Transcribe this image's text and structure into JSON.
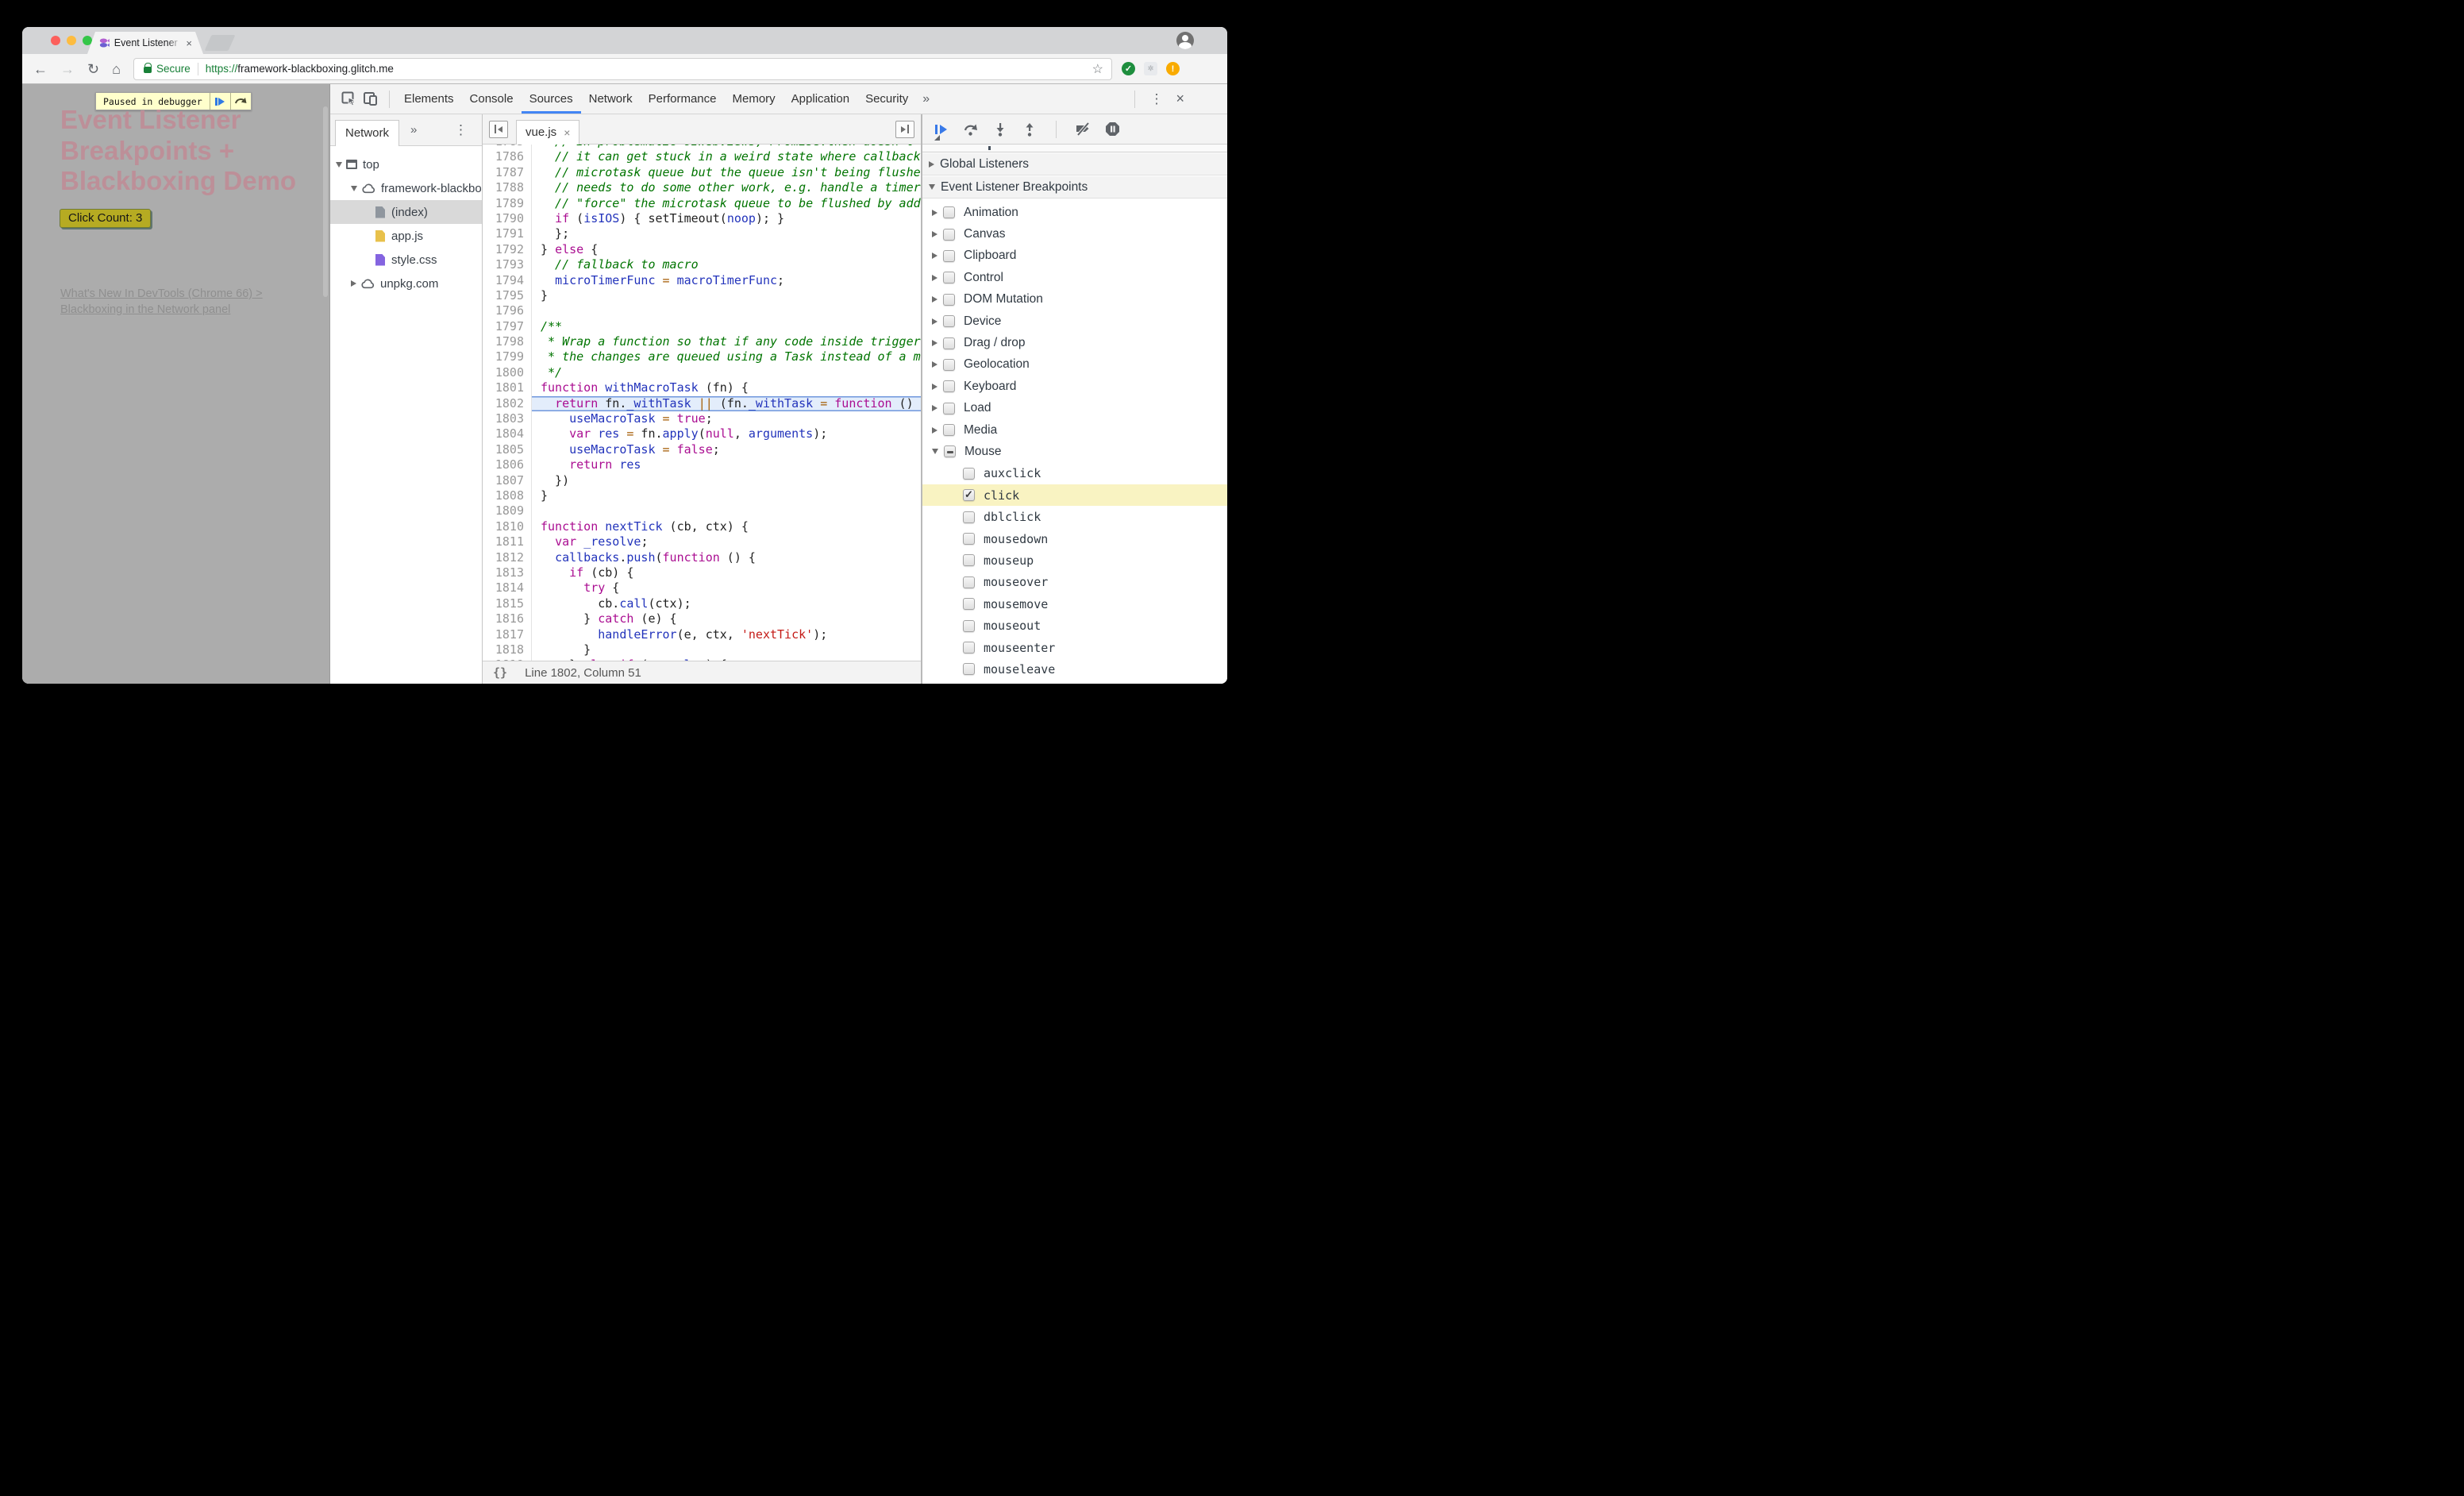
{
  "browser": {
    "tab_title": "Event Listener Breakpoints + B",
    "secure_label": "Secure",
    "url_scheme": "https://",
    "url_host": "framework-blackboxing.glitch.me"
  },
  "icons": {
    "back": "←",
    "forward": "→",
    "reload": "↻",
    "home": "⌂",
    "star": "☆",
    "overflow": "»",
    "menu": "⋮",
    "close": "×",
    "tab_close": "×",
    "braces": "{}",
    "ext_warning": "!",
    "ext_check": "✓",
    "ext_faint": "✲"
  },
  "page": {
    "paused_label": "Paused in debugger",
    "heading_line1": "Event Listener",
    "heading_line2": "Breakpoints +",
    "heading_line3": "Blackboxing Demo",
    "button_label": "Click Count: 3",
    "link_line1": "What's New In DevTools (Chrome 66) >",
    "link_line2": "Blackboxing in the Network panel"
  },
  "devtools": {
    "tabs": [
      {
        "label": "Elements"
      },
      {
        "label": "Console"
      },
      {
        "label": "Sources",
        "active": true
      },
      {
        "label": "Network"
      },
      {
        "label": "Performance"
      },
      {
        "label": "Memory"
      },
      {
        "label": "Application"
      },
      {
        "label": "Security"
      }
    ],
    "sidebar": {
      "tab_label": "Network",
      "tree": [
        {
          "kind": "frame",
          "label": "top",
          "expanded": true,
          "depth": 0
        },
        {
          "kind": "cloud",
          "label": "framework-blackboxing.glitch.me",
          "expanded": true,
          "depth": 1
        },
        {
          "kind": "file",
          "label": "(index)",
          "color": "#8f969e",
          "selected": true,
          "depth": 2
        },
        {
          "kind": "file",
          "label": "app.js",
          "color": "#e8c14b",
          "depth": 2
        },
        {
          "kind": "file",
          "label": "style.css",
          "color": "#8464e0",
          "depth": 2
        },
        {
          "kind": "cloud",
          "label": "unpkg.com",
          "expanded": false,
          "depth": 1
        }
      ]
    },
    "editor": {
      "file_tab_label": "vue.js",
      "status_text": "Line 1802, Column 51",
      "execution_line": 1802,
      "lines": [
        {
          "n": 1785,
          "t": [
            [
              "c",
              "  // In problematic UIWebViews, Promise.then doesn't completely break, but"
            ]
          ]
        },
        {
          "n": 1786,
          "t": [
            [
              "c",
              "  // it can get stuck in a weird state where callbacks are pushed into the"
            ]
          ]
        },
        {
          "n": 1787,
          "t": [
            [
              "c",
              "  // microtask queue but the queue isn't being flushed, until the browser"
            ]
          ]
        },
        {
          "n": 1788,
          "t": [
            [
              "c",
              "  // needs to do some other work, e.g. handle a timer. Therefore we can"
            ]
          ]
        },
        {
          "n": 1789,
          "t": [
            [
              "c",
              "  // \"force\" the microtask queue to be flushed by adding an empty timer."
            ]
          ]
        },
        {
          "n": 1790,
          "t": [
            [
              "p",
              "  "
            ],
            [
              "k",
              "if"
            ],
            [
              "p",
              " ("
            ],
            [
              "v",
              "isIOS"
            ],
            [
              "p",
              ") { setTimeout("
            ],
            [
              "v",
              "noop"
            ],
            [
              "p",
              "); }"
            ]
          ]
        },
        {
          "n": 1791,
          "t": [
            [
              "p",
              "  };"
            ]
          ]
        },
        {
          "n": 1792,
          "t": [
            [
              "p",
              "} "
            ],
            [
              "k",
              "else"
            ],
            [
              "p",
              " {"
            ]
          ]
        },
        {
          "n": 1793,
          "t": [
            [
              "c",
              "  // fallback to macro"
            ]
          ]
        },
        {
          "n": 1794,
          "t": [
            [
              "p",
              "  "
            ],
            [
              "v",
              "microTimerFunc"
            ],
            [
              "p",
              " "
            ],
            [
              "o",
              "="
            ],
            [
              "p",
              " "
            ],
            [
              "v",
              "macroTimerFunc"
            ],
            [
              "p",
              ";"
            ]
          ]
        },
        {
          "n": 1795,
          "t": [
            [
              "p",
              "}"
            ]
          ]
        },
        {
          "n": 1796,
          "t": []
        },
        {
          "n": 1797,
          "t": [
            [
              "c",
              "/**"
            ]
          ]
        },
        {
          "n": 1798,
          "t": [
            [
              "c",
              " * Wrap a function so that if any code inside triggers state change,"
            ]
          ]
        },
        {
          "n": 1799,
          "t": [
            [
              "c",
              " * the changes are queued using a Task instead of a microtask."
            ]
          ]
        },
        {
          "n": 1800,
          "t": [
            [
              "c",
              " */"
            ]
          ]
        },
        {
          "n": 1801,
          "t": [
            [
              "k",
              "function"
            ],
            [
              "p",
              " "
            ],
            [
              "v",
              "withMacroTask"
            ],
            [
              "p",
              " (fn) {"
            ]
          ]
        },
        {
          "n": 1802,
          "t": [
            [
              "p",
              "  "
            ],
            [
              "k",
              "return"
            ],
            [
              "p",
              " fn."
            ],
            [
              "v",
              "_withTask"
            ],
            [
              "p",
              " "
            ],
            [
              "o",
              "||"
            ],
            [
              "p",
              " (fn."
            ],
            [
              "v",
              "_withTask"
            ],
            [
              "p",
              " "
            ],
            [
              "o",
              "="
            ],
            [
              "p",
              " "
            ],
            [
              "k",
              "function"
            ],
            [
              "p",
              " () {"
            ]
          ]
        },
        {
          "n": 1803,
          "t": [
            [
              "p",
              "    "
            ],
            [
              "v",
              "useMacroTask"
            ],
            [
              "p",
              " "
            ],
            [
              "o",
              "="
            ],
            [
              "p",
              " "
            ],
            [
              "k",
              "true"
            ],
            [
              "p",
              ";"
            ]
          ]
        },
        {
          "n": 1804,
          "t": [
            [
              "p",
              "    "
            ],
            [
              "k",
              "var"
            ],
            [
              "p",
              " "
            ],
            [
              "v",
              "res"
            ],
            [
              "p",
              " "
            ],
            [
              "o",
              "="
            ],
            [
              "p",
              " fn."
            ],
            [
              "v",
              "apply"
            ],
            [
              "p",
              "("
            ],
            [
              "k",
              "null"
            ],
            [
              "p",
              ", "
            ],
            [
              "v",
              "arguments"
            ],
            [
              "p",
              ");"
            ]
          ]
        },
        {
          "n": 1805,
          "t": [
            [
              "p",
              "    "
            ],
            [
              "v",
              "useMacroTask"
            ],
            [
              "p",
              " "
            ],
            [
              "o",
              "="
            ],
            [
              "p",
              " "
            ],
            [
              "k",
              "false"
            ],
            [
              "p",
              ";"
            ]
          ]
        },
        {
          "n": 1806,
          "t": [
            [
              "p",
              "    "
            ],
            [
              "k",
              "return"
            ],
            [
              "p",
              " "
            ],
            [
              "v",
              "res"
            ]
          ]
        },
        {
          "n": 1807,
          "t": [
            [
              "p",
              "  })"
            ]
          ]
        },
        {
          "n": 1808,
          "t": [
            [
              "p",
              "}"
            ]
          ]
        },
        {
          "n": 1809,
          "t": []
        },
        {
          "n": 1810,
          "t": [
            [
              "k",
              "function"
            ],
            [
              "p",
              " "
            ],
            [
              "v",
              "nextTick"
            ],
            [
              "p",
              " (cb, ctx) {"
            ]
          ]
        },
        {
          "n": 1811,
          "t": [
            [
              "p",
              "  "
            ],
            [
              "k",
              "var"
            ],
            [
              "p",
              " "
            ],
            [
              "v",
              "_resolve"
            ],
            [
              "p",
              ";"
            ]
          ]
        },
        {
          "n": 1812,
          "t": [
            [
              "p",
              "  "
            ],
            [
              "v",
              "callbacks"
            ],
            [
              "p",
              "."
            ],
            [
              "v",
              "push"
            ],
            [
              "p",
              "("
            ],
            [
              "k",
              "function"
            ],
            [
              "p",
              " () {"
            ]
          ]
        },
        {
          "n": 1813,
          "t": [
            [
              "p",
              "    "
            ],
            [
              "k",
              "if"
            ],
            [
              "p",
              " (cb) {"
            ]
          ]
        },
        {
          "n": 1814,
          "t": [
            [
              "p",
              "      "
            ],
            [
              "k",
              "try"
            ],
            [
              "p",
              " {"
            ]
          ]
        },
        {
          "n": 1815,
          "t": [
            [
              "p",
              "        cb."
            ],
            [
              "v",
              "call"
            ],
            [
              "p",
              "(ctx);"
            ]
          ]
        },
        {
          "n": 1816,
          "t": [
            [
              "p",
              "      } "
            ],
            [
              "k",
              "catch"
            ],
            [
              "p",
              " (e) {"
            ]
          ]
        },
        {
          "n": 1817,
          "t": [
            [
              "p",
              "        "
            ],
            [
              "v",
              "handleError"
            ],
            [
              "p",
              "(e, ctx, "
            ],
            [
              "s",
              "'nextTick'"
            ],
            [
              "p",
              ");"
            ]
          ]
        },
        {
          "n": 1818,
          "t": [
            [
              "p",
              "      }"
            ]
          ]
        },
        {
          "n": 1819,
          "t": [
            [
              "p",
              "    } "
            ],
            [
              "k",
              "else"
            ],
            [
              "p",
              " "
            ],
            [
              "k",
              "if"
            ],
            [
              "p",
              " ("
            ],
            [
              "v",
              "_resolve"
            ],
            [
              "p",
              ") {"
            ]
          ]
        }
      ]
    },
    "breakpoints": {
      "section1": "Global Listeners",
      "section2": "Event Listener Breakpoints",
      "categories": [
        {
          "label": "Animation"
        },
        {
          "label": "Canvas"
        },
        {
          "label": "Clipboard"
        },
        {
          "label": "Control"
        },
        {
          "label": "DOM Mutation"
        },
        {
          "label": "Device"
        },
        {
          "label": "Drag / drop"
        },
        {
          "label": "Geolocation"
        },
        {
          "label": "Keyboard"
        },
        {
          "label": "Load"
        },
        {
          "label": "Media"
        },
        {
          "label": "Mouse",
          "expanded": true,
          "indeterminate": true
        }
      ],
      "mouse_children": [
        {
          "label": "auxclick"
        },
        {
          "label": "click",
          "checked": true,
          "highlighted": true
        },
        {
          "label": "dblclick"
        },
        {
          "label": "mousedown"
        },
        {
          "label": "mouseup"
        },
        {
          "label": "mouseover"
        },
        {
          "label": "mousemove"
        },
        {
          "label": "mouseout"
        },
        {
          "label": "mouseenter"
        },
        {
          "label": "mouseleave"
        }
      ]
    }
  },
  "colors": {
    "accent_blue": "#4285f4",
    "exec_line_bg": "#e3edfb",
    "exec_line_border": "#6f97dd",
    "selected_event_bg": "#f9f3c2",
    "syntax_keyword": "#aa0d91",
    "syntax_variable": "#2233bb",
    "syntax_comment": "#007400",
    "syntax_string": "#c41a16",
    "syntax_operator": "#a35a00",
    "secure_green": "#188038",
    "heading_pink": "#bd8f98",
    "click_button_bg": "#b6ab22"
  }
}
